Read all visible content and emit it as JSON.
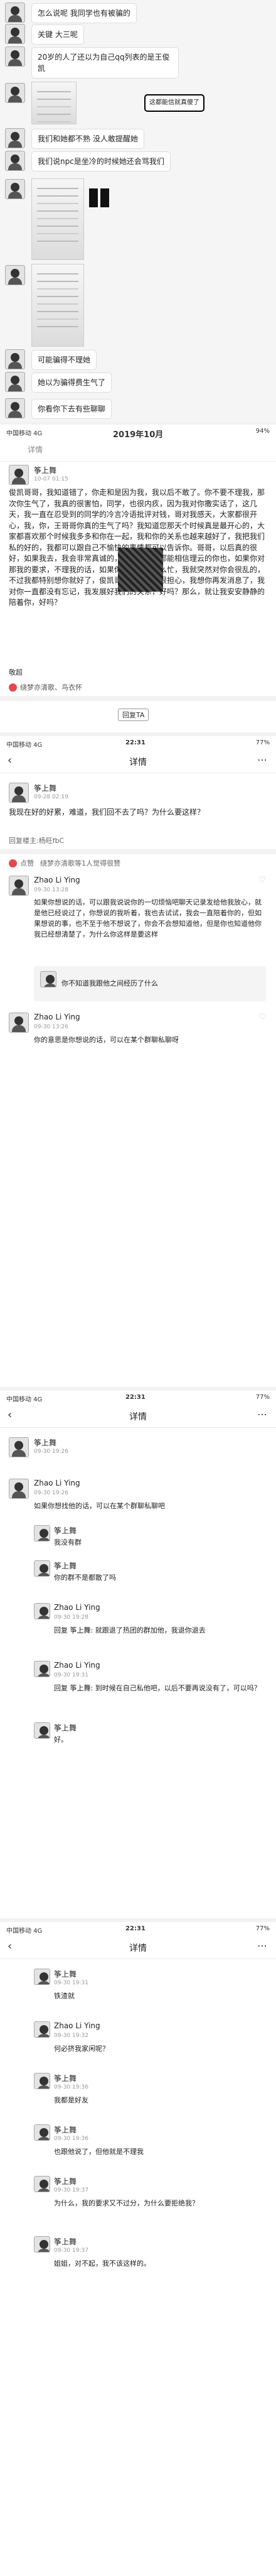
{
  "chat": {
    "m1": "怎么说呢 我同学也有被骗的",
    "m2": "关键 大三呢",
    "m3": "20岁的人了还以为自己qq列表的是王俊凯",
    "image_caption": "这都能信就真傻了",
    "m4": "我们和她都不熟 没人敢提醒她",
    "m5": "我们说npc是坐冷的时候她还会骂我们",
    "m6": "可能骗得不理她",
    "m7": "她以为骗得费生气了",
    "m8": "你看你下去有些聊聊"
  },
  "panel1": {
    "status_left": "中国移动 4G",
    "status_title": "2019年10月",
    "status_right": "94%",
    "nav_title": "详情",
    "user": "筝上舞",
    "time": "10-07 01:15",
    "text": "俊凯哥哥，我知道错了，你走和是因为我，我以后不敢了。你不要不理我，那次你生气了，我真的很害怕，同学，也很内疚，因为我对你撒实话了，这几天，我一直在忍受到的同学的冷言冷语批评对钱，哥对我感天，大家都很开心，我，你，王哥哥你真的生气了吗？我知道您那天个时候真是最开心的，大家都喜欢那个时候我多多和你在一起，我和你的关系也越来越好了，我把我们私的好的，我都可以跟自己不愉快的事情都可以告诉你。哥哥，以后真的很好，如果我去，我会非常真诚的，但是我和你都能相信理云的你也，如果你对那我的要求，不理我的话，如果你工作没有那么忙，我就突然对你会很乱的，不过我都特别想你就好了，俊凯哥哥，我真的很担心，我想你再发消息了，我对你一直都没有忘记，我发展好我们的关系，好吗？那么，就让我安安静静的陪着你，好吗？",
    "sign": "敬超",
    "likes": "绕梦亦清歌、鸟衣怀",
    "tag": "回复TA"
  },
  "panel2": {
    "status_left": "中国移动 4G",
    "status_time": "22:31",
    "status_right": "77%",
    "nav_title": "详情",
    "user": "筝上舞",
    "time": "09-28 02:19",
    "text": "我现在好的好累，难道，我们回不去了吗？为什么要这样？",
    "source": "回复楼主:杨旺fbC",
    "likes_label": "点赞",
    "likes": "绕梦亦清歌等1人觉得很赞",
    "c1_user": "Zhao Li Ying",
    "c1_time": "09-30 13:28",
    "c1_text": "如果你想说的话，可以跟我说说你的一切烦恼吧聊天记录发给他我放心，就是他已经说过了，你想说的我听着，我也去试试，我会一直陪着你的，但如果想说的事，也不至于他不想说了，你会不会想知道他，但是你也知道他你我已经想清楚了，为什么你这样是要这样",
    "c1_reply": "你不知道我跟他之间经历了什么",
    "c2_user": "Zhao Li Ying",
    "c2_time": "09-30 13:26",
    "c2_text": "你的意思是你想说的话，可以在某个群聊私聊呀"
  },
  "panel3": {
    "status_left": "中国移动 4G",
    "status_time": "22:31",
    "status_right": "77%",
    "nav_title": "详情",
    "user": "筝上舞",
    "time": "09-30 19:26",
    "c1_user": "Zhao Li Ying",
    "c1_time": "09-30 19:26",
    "c1_text": "如果你想找他的话，可以在某个群聊私聊吧",
    "r1_user": "筝上舞",
    "r1_text": "我没有群",
    "r2_user": "筝上舞",
    "r2_text": "你的群不是都散了吗",
    "c2_user": "Zhao Li Ying",
    "c2_time": "09-30 19:28",
    "c2_text": "回复 筝上舞: 就跟退了热团的群加他，我退你退去",
    "c3_user": "Zhao Li Ying",
    "c3_time": "09-30 19:31",
    "c3_text": "回复 筝上舞: 到时候在自己私他吧，以后不要再说没有了，可以吗？",
    "r3_user": "筝上舞",
    "r3_text": "好。"
  },
  "panel4": {
    "status_left": "中国移动 4G",
    "status_time": "22:31",
    "status_right": "77%",
    "nav_title": "详情",
    "r1_user": "筝上舞",
    "r1_time": "09-30 19:31",
    "r1_text": "铁渣就",
    "c1_user": "Zhao Li Ying",
    "c1_time": "09-30 19:32",
    "c1_text": "何必挤我家闲呢？",
    "r2_user": "筝上舞",
    "r2_time": "09-30 19:36",
    "r2_text": "我都是好友",
    "r3_user": "筝上舞",
    "r3_time": "09-30 19:36",
    "r3_text": "也跟他说了，但他就是不理我",
    "r4_user": "筝上舞",
    "r4_time": "09-30 19:37",
    "r4_text": "为什么，我的要求又不过分，为什么要拒绝我？",
    "r5_user": "筝上舞",
    "r5_time": "09-30 19:37",
    "r5_text": "姐姐，对不起，我不该这样的。"
  }
}
